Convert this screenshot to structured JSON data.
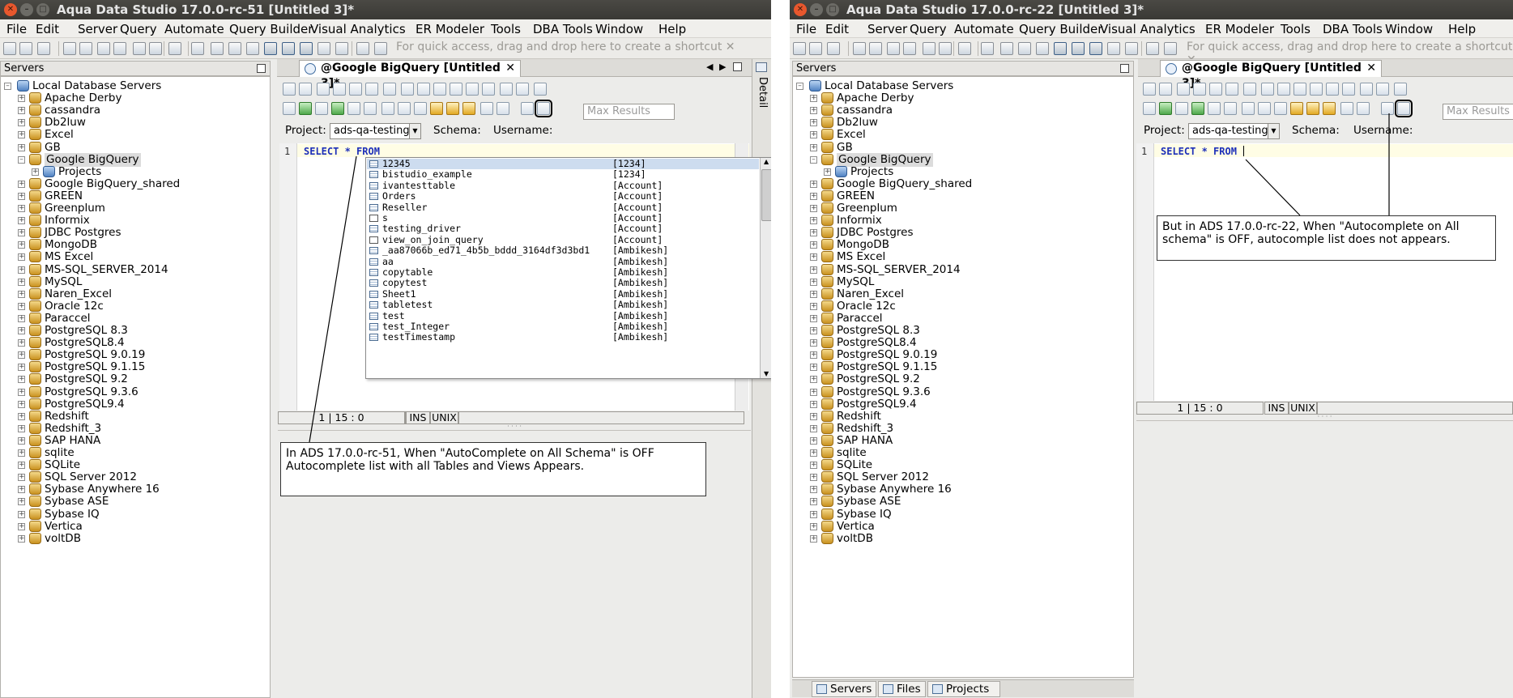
{
  "left": {
    "title": "Aqua Data Studio 17.0.0-rc-51 [Untitled 3]*",
    "menu": [
      "File",
      "Edit",
      "Server",
      "Query",
      "Automate",
      "Query Builder",
      "Visual Analytics",
      "ER Modeler",
      "Tools",
      "DBA Tools",
      "Window",
      "Help"
    ],
    "shortcut_hint": "For quick access, drag and drop here to create a shortcut",
    "servers_header": "Servers",
    "tree_root": "Local Database Servers",
    "servers": [
      "Apache Derby",
      "cassandra",
      "Db2luw",
      "Excel",
      "GB",
      "Google BigQuery",
      "Projects",
      "Google BigQuery_shared",
      "GREEN",
      "Greenplum",
      "Informix",
      "JDBC Postgres",
      "MongoDB",
      "MS Excel",
      "MS-SQL_SERVER_2014",
      "MySQL",
      "Naren_Excel",
      "Oracle 12c",
      "Paraccel",
      "PostgreSQL 8.3",
      "PostgreSQL8.4",
      "PostgreSQL 9.0.19",
      "PostgreSQL 9.1.15",
      "PostgreSQL 9.2",
      "PostgreSQL 9.3.6",
      "PostgreSQL9.4",
      "Redshift",
      "Redshift_3",
      "SAP HANA",
      "sqlite",
      "SQLite",
      "SQL Server 2012",
      "Sybase Anywhere 16",
      "Sybase ASE",
      "Sybase IQ",
      "Vertica",
      "voltDB"
    ],
    "tab_label": "@Google BigQuery [Untitled 3]*",
    "max_results_placeholder": "Max Results",
    "project_label": "Project:",
    "project_value": "ads-qa-testing",
    "schema_label": "Schema:",
    "username_label": "Username:",
    "line_number": "1",
    "code": "SELECT * FROM",
    "detail_label": "Detail",
    "autocomplete": [
      {
        "name": "12345",
        "schema": "[1234]",
        "icon": "table-icon"
      },
      {
        "name": "bistudio_example",
        "schema": "[1234]",
        "icon": "table-icon"
      },
      {
        "name": "ivantesttable",
        "schema": "[Account]",
        "icon": "table-icon"
      },
      {
        "name": "Orders",
        "schema": "[Account]",
        "icon": "table-icon"
      },
      {
        "name": "Reseller",
        "schema": "[Account]",
        "icon": "table-icon"
      },
      {
        "name": "s",
        "schema": "[Account]",
        "icon": "view-icon"
      },
      {
        "name": "testing_driver",
        "schema": "[Account]",
        "icon": "table-icon"
      },
      {
        "name": "view_on_join_query",
        "schema": "[Account]",
        "icon": "view-icon"
      },
      {
        "name": "_aa87066b_ed71_4b5b_bddd_3164df3d3bd1",
        "schema": "[Ambikesh]",
        "icon": "table-icon"
      },
      {
        "name": "aa",
        "schema": "[Ambikesh]",
        "icon": "table-icon"
      },
      {
        "name": "copytable",
        "schema": "[Ambikesh]",
        "icon": "table-icon"
      },
      {
        "name": "copytest",
        "schema": "[Ambikesh]",
        "icon": "table-icon"
      },
      {
        "name": "Sheet1",
        "schema": "[Ambikesh]",
        "icon": "table-icon"
      },
      {
        "name": "tabletest",
        "schema": "[Ambikesh]",
        "icon": "table-icon"
      },
      {
        "name": "test",
        "schema": "[Ambikesh]",
        "icon": "table-icon"
      },
      {
        "name": "test_Integer",
        "schema": "[Ambikesh]",
        "icon": "table-icon"
      },
      {
        "name": "testTimestamp",
        "schema": "[Ambikesh]",
        "icon": "table-icon"
      }
    ],
    "status_pos": "1 | 15 : 0",
    "status_ins": "INS",
    "status_eol": "UNIX",
    "note": "In ADS 17.0.0-rc-51, When \"AutoComplete on All Schema\" is OFF Autocomplete list with all Tables and Views Appears."
  },
  "right": {
    "title": "Aqua Data Studio 17.0.0-rc-22 [Untitled 3]*",
    "menu": [
      "File",
      "Edit",
      "Server",
      "Query",
      "Automate",
      "Query Builder",
      "Visual Analytics",
      "ER Modeler",
      "Tools",
      "DBA Tools",
      "Window",
      "Help"
    ],
    "shortcut_hint": "For quick access, drag and drop here to create a shortcut",
    "servers_header": "Servers",
    "tree_root": "Local Database Servers",
    "servers": [
      "Apache Derby",
      "cassandra",
      "Db2luw",
      "Excel",
      "GB",
      "Google BigQuery",
      "Projects",
      "Google BigQuery_shared",
      "GREEN",
      "Greenplum",
      "Informix",
      "JDBC Postgres",
      "MongoDB",
      "MS Excel",
      "MS-SQL_SERVER_2014",
      "MySQL",
      "Naren_Excel",
      "Oracle 12c",
      "Paraccel",
      "PostgreSQL 8.3",
      "PostgreSQL8.4",
      "PostgreSQL 9.0.19",
      "PostgreSQL 9.1.15",
      "PostgreSQL 9.2",
      "PostgreSQL 9.3.6",
      "PostgreSQL9.4",
      "Redshift",
      "Redshift_3",
      "SAP HANA",
      "sqlite",
      "SQLite",
      "SQL Server 2012",
      "Sybase Anywhere 16",
      "Sybase ASE",
      "Sybase IQ",
      "Vertica",
      "voltDB"
    ],
    "tab_label": "@Google BigQuery [Untitled 3]*",
    "max_results_placeholder": "Max Results",
    "project_label": "Project:",
    "project_value": "ads-qa-testing",
    "schema_label": "Schema:",
    "username_label": "Username:",
    "line_number": "1",
    "code": "SELECT * FROM",
    "status_pos": "1 | 15 : 0",
    "status_ins": "INS",
    "status_eol": "UNIX",
    "note": "But in ADS 17.0.0-rc-22, When \"Autocomplete on All schema\" is OFF, autocomple list does not appears.",
    "bottom_tabs": [
      "Servers",
      "Files",
      "Projects"
    ]
  }
}
